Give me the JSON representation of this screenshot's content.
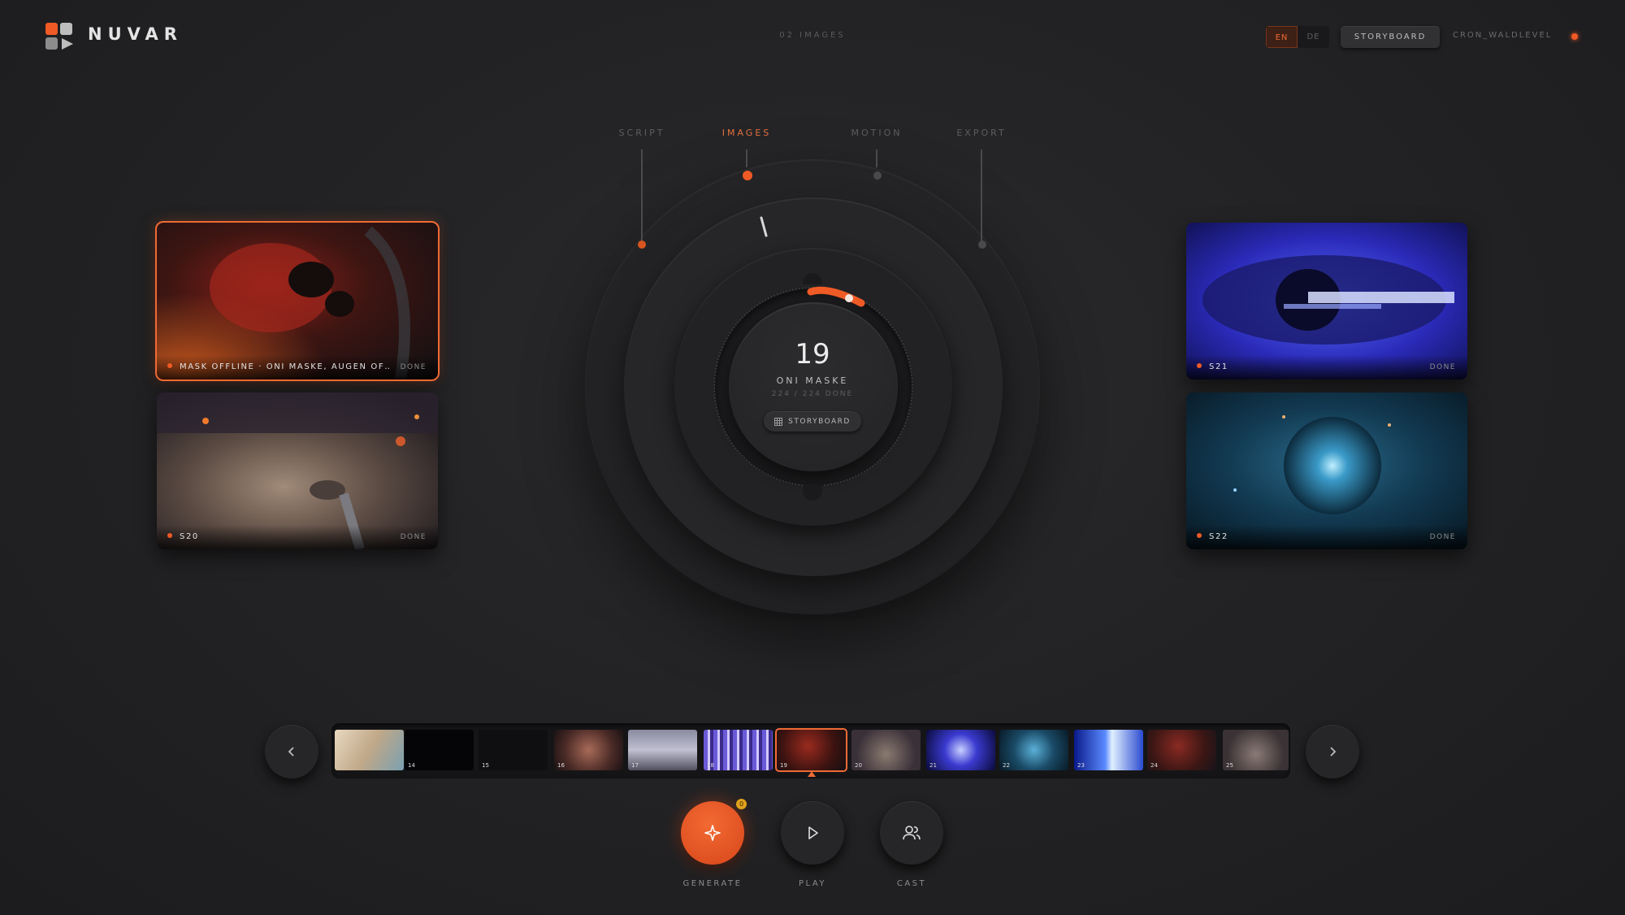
{
  "app": {
    "brand": "NUVAR",
    "image_count": "02 IMAGES"
  },
  "header": {
    "languages": [
      {
        "label": "EN",
        "active": true
      },
      {
        "label": "DE",
        "active": false
      }
    ],
    "storyboard_button": "STORYBOARD",
    "user": "CRON_WALDLEVEL",
    "accent": "#ef5a25"
  },
  "steps": [
    {
      "label": "SCRIPT",
      "active": false
    },
    {
      "label": "IMAGES",
      "active": true
    },
    {
      "label": "MOTION",
      "active": false
    },
    {
      "label": "EXPORT",
      "active": false
    }
  ],
  "dial": {
    "scene_number": "19",
    "scene_title": "ONI MASKE",
    "progress_text": "224 / 224 DONE",
    "button_label": "STORYBOARD"
  },
  "cards": [
    {
      "label": "MASK OFFLINE · ONI MASKE, AUGEN OF…",
      "status": "DONE",
      "selected": true,
      "scene": "19"
    },
    {
      "label": "S20",
      "status": "DONE",
      "selected": false,
      "scene": "20"
    },
    {
      "label": "S21",
      "status": "DONE",
      "selected": false,
      "scene": "21"
    },
    {
      "label": "S22",
      "status": "DONE",
      "selected": false,
      "scene": "22"
    }
  ],
  "filmstrip": {
    "thumbnails": [
      {
        "number": ""
      },
      {
        "number": "14"
      },
      {
        "number": "15"
      },
      {
        "number": "16"
      },
      {
        "number": "17"
      },
      {
        "number": "18"
      },
      {
        "number": "19",
        "selected": true
      },
      {
        "number": "20"
      },
      {
        "number": "21"
      },
      {
        "number": "22"
      },
      {
        "number": "23"
      },
      {
        "number": "24"
      },
      {
        "number": "25"
      }
    ]
  },
  "actions": {
    "generate": {
      "label": "GENERATE",
      "badge": "0"
    },
    "play": {
      "label": "PLAY"
    },
    "cast": {
      "label": "CAST"
    }
  }
}
